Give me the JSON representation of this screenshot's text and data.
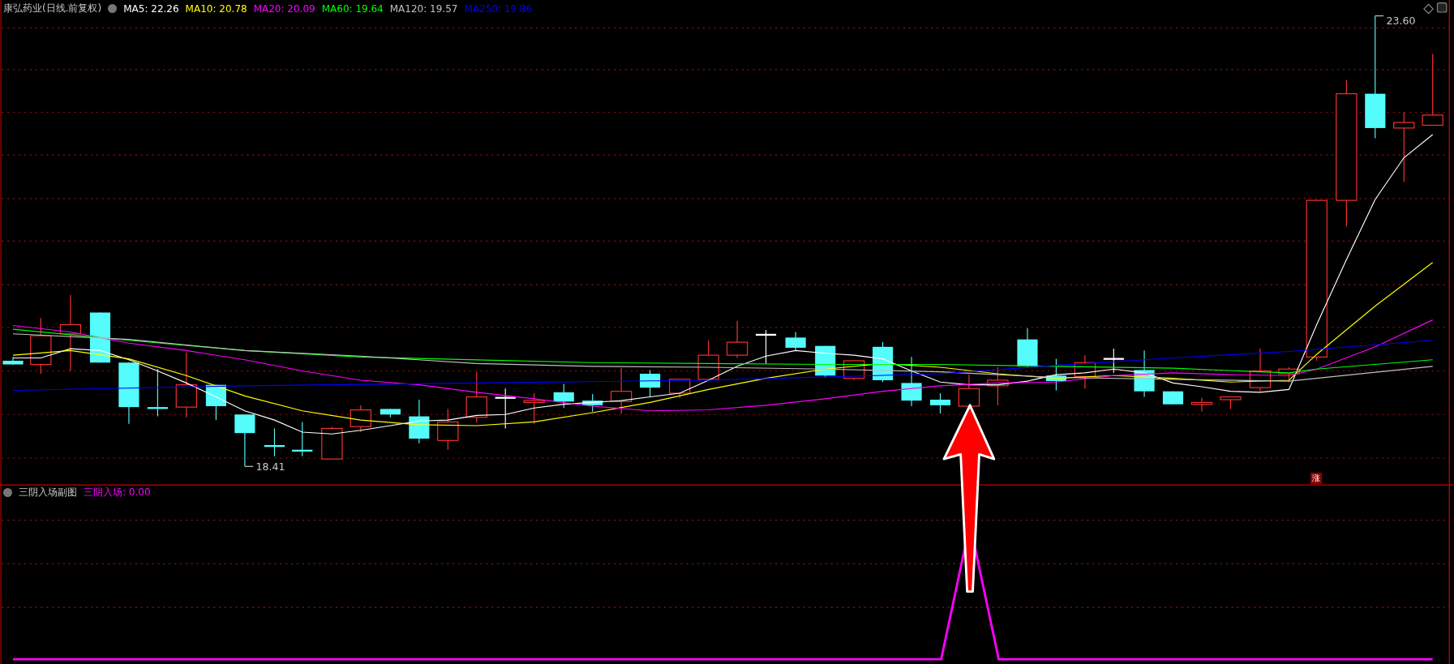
{
  "main_panel": {
    "title": "康弘药业(日线.前复权)",
    "ma_legend": [
      {
        "label": "MA5: 22.26",
        "color": "#ffffff"
      },
      {
        "label": "MA10: 20.78",
        "color": "#ffff00"
      },
      {
        "label": "MA20: 20.09",
        "color": "#ff00ff"
      },
      {
        "label": "MA60: 19.64",
        "color": "#00ff00"
      },
      {
        "label": "MA120: 19.57",
        "color": "#c0c0c0"
      },
      {
        "label": "MA250: 19.86",
        "color": "#0000ff"
      }
    ],
    "high_label": "23.60",
    "low_label": "18.41",
    "badge": "涨"
  },
  "sub_panel": {
    "title": "三阴入场副图",
    "indicator": "三阴入场: 0.00"
  }
}
